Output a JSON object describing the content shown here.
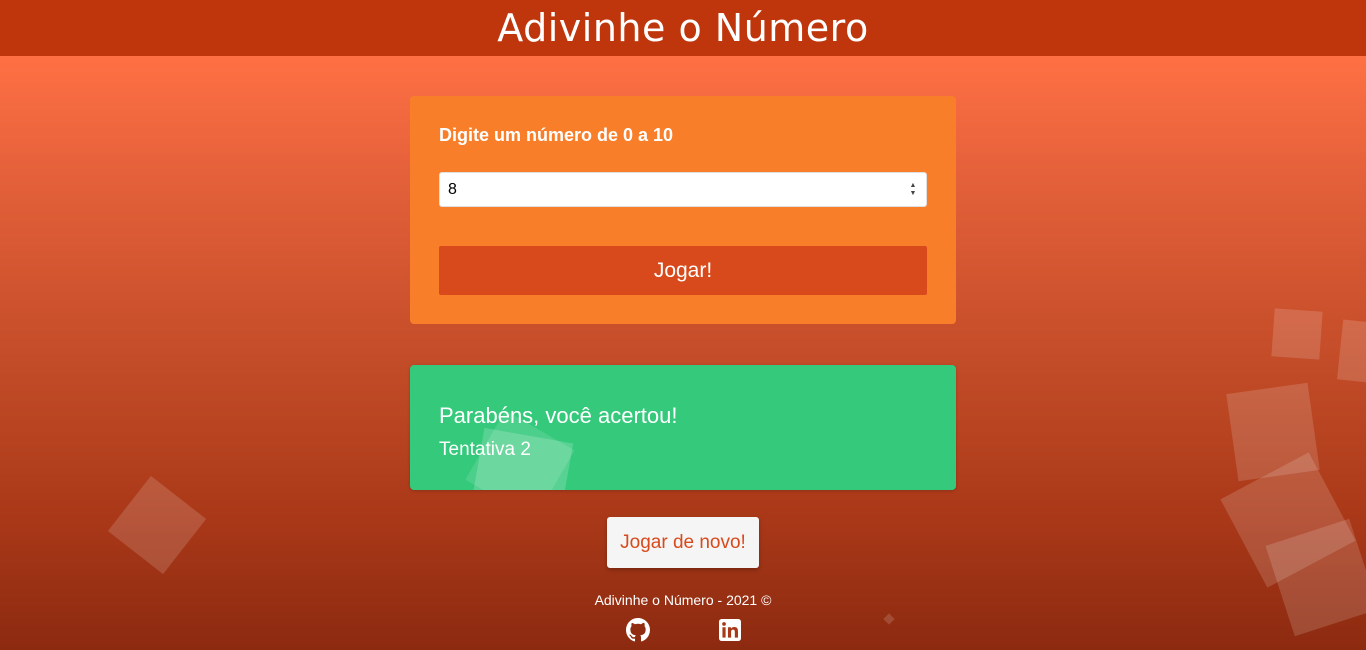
{
  "header": {
    "title": "Adivinhe o Número"
  },
  "game": {
    "prompt": "Digite um número de 0 a 10",
    "input_value": "8",
    "play_label": "Jogar!"
  },
  "result": {
    "message": "Parabéns, você acertou!",
    "attempt": "Tentativa 2"
  },
  "again_label": "Jogar de novo!",
  "footer": {
    "text": "Adivinhe o Número - 2021 ©",
    "links": [
      {
        "icon": "github-icon"
      },
      {
        "icon": "linkedin-icon"
      }
    ]
  },
  "colors": {
    "header": "#bf360c",
    "card": "#f97e29",
    "button": "#d84a1b",
    "success": "#34c97b"
  }
}
